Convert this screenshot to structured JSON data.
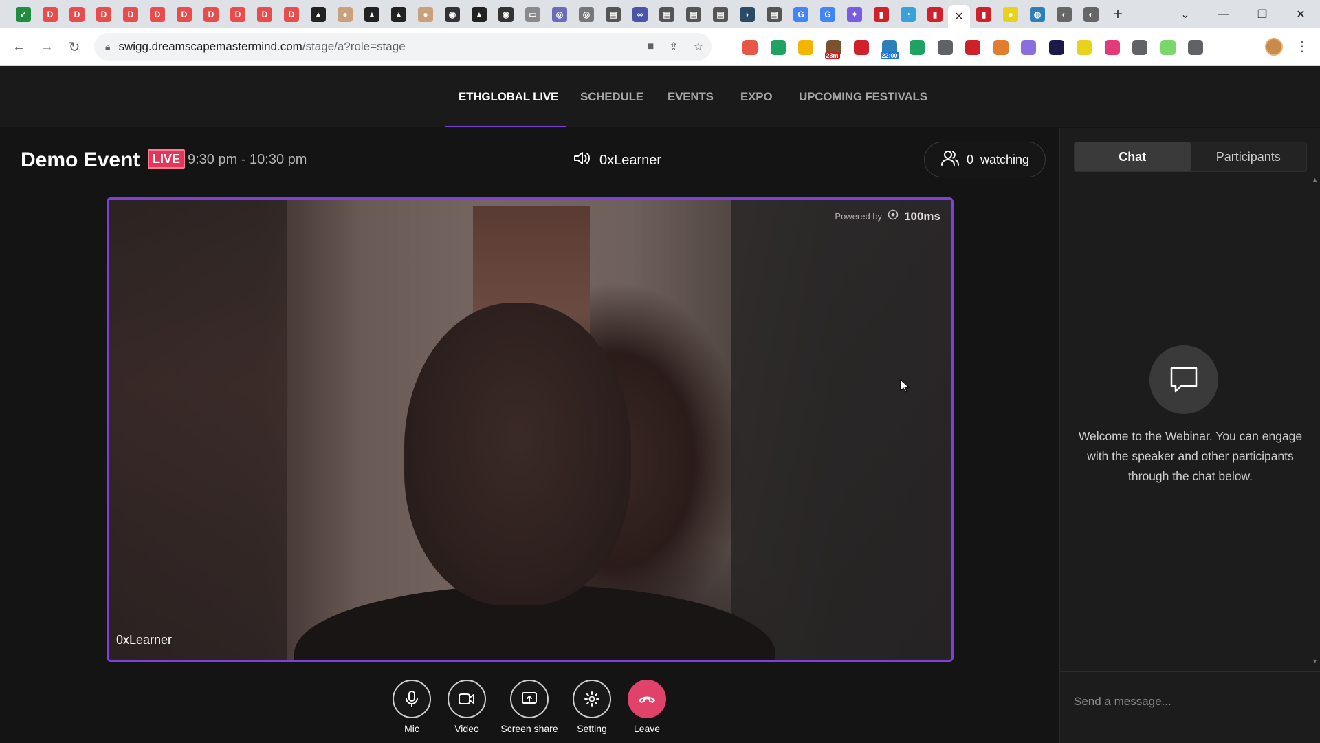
{
  "browser": {
    "url_host": "swigg.dreamscapemastermind.com",
    "url_path": "/stage/a?role=stage",
    "tab_close": "✕",
    "new_tab": "+",
    "tab_icons": [
      {
        "color": "#1e8e3e",
        "glyph": "✓"
      },
      {
        "color": "#e84d4d",
        "glyph": "D"
      },
      {
        "color": "#e84d4d",
        "glyph": "D"
      },
      {
        "color": "#e84d4d",
        "glyph": "D"
      },
      {
        "color": "#e84d4d",
        "glyph": "D"
      },
      {
        "color": "#e84d4d",
        "glyph": "D"
      },
      {
        "color": "#e84d4d",
        "glyph": "D"
      },
      {
        "color": "#e84d4d",
        "glyph": "D"
      },
      {
        "color": "#e84d4d",
        "glyph": "D"
      },
      {
        "color": "#e84d4d",
        "glyph": "D"
      },
      {
        "color": "#e84d4d",
        "glyph": "D"
      },
      {
        "color": "#222222",
        "glyph": "▲"
      },
      {
        "color": "#c9a07a",
        "glyph": "●"
      },
      {
        "color": "#222222",
        "glyph": "▲"
      },
      {
        "color": "#222222",
        "glyph": "▲"
      },
      {
        "color": "#c9a07a",
        "glyph": "●"
      },
      {
        "color": "#333333",
        "glyph": "◉"
      },
      {
        "color": "#222222",
        "glyph": "▲"
      },
      {
        "color": "#333333",
        "glyph": "◉"
      },
      {
        "color": "#8a8a8a",
        "glyph": "▭"
      },
      {
        "color": "#6b6bb8",
        "glyph": "◎"
      },
      {
        "color": "#777777",
        "glyph": "◎"
      },
      {
        "color": "#555555",
        "glyph": "▤"
      },
      {
        "color": "#4a55a8",
        "glyph": "∞"
      },
      {
        "color": "#555555",
        "glyph": "▤"
      },
      {
        "color": "#555555",
        "glyph": "▤"
      },
      {
        "color": "#555555",
        "glyph": "▤"
      },
      {
        "color": "#2a4a66",
        "glyph": "◗"
      },
      {
        "color": "#555555",
        "glyph": "▤"
      },
      {
        "color": "#4285f4",
        "glyph": "G"
      },
      {
        "color": "#4285f4",
        "glyph": "G"
      },
      {
        "color": "#7a5ce0",
        "glyph": "✦"
      },
      {
        "color": "#d0202a",
        "glyph": "▮"
      },
      {
        "color": "#3aa0d8",
        "glyph": "◔"
      },
      {
        "color": "#d0202a",
        "glyph": "▮"
      }
    ],
    "tab_icons_after": [
      {
        "color": "#d0202a",
        "glyph": "▮"
      },
      {
        "color": "#e8d21a",
        "glyph": "●"
      },
      {
        "color": "#2c7fb8",
        "glyph": "◍"
      },
      {
        "color": "#666666",
        "glyph": "◐"
      },
      {
        "color": "#666666",
        "glyph": "◐"
      }
    ],
    "ext_colors": [
      "#e8564a",
      "#1ea362",
      "#f4b400",
      "#7a5230",
      "#d0202a",
      "#2c7fb8",
      "#1ea362",
      "#5f6368",
      "#d0202a",
      "#e27c2e",
      "#8a6ee0",
      "#1a1a4a",
      "#e8d21a",
      "#e23a7a",
      "#5f6368",
      "#7ad86b",
      "#5f6368"
    ],
    "ext_badge_1": "23m",
    "ext_badge_2": "22:00"
  },
  "appnav": {
    "items": [
      "ETHGLOBAL LIVE",
      "SCHEDULE",
      "EVENTS",
      "EXPO",
      "UPCOMING FESTIVALS"
    ]
  },
  "stage": {
    "title": "Demo Event",
    "live_label": "LIVE",
    "time_range": "9:30 pm - 10:30 pm",
    "speaker_name": "0xLearner",
    "watching_count": "0",
    "watching_label": "watching"
  },
  "video": {
    "powered_by": "Powered by",
    "brand": "100ms",
    "participant_name": "0xLearner"
  },
  "controls": [
    {
      "label": "Mic",
      "icon": "mic-icon"
    },
    {
      "label": "Video",
      "icon": "video-camera-icon"
    },
    {
      "label": "Screen share",
      "icon": "screen-share-icon"
    },
    {
      "label": "Setting",
      "icon": "gear-icon"
    },
    {
      "label": "Leave",
      "icon": "phone-hangup-icon"
    }
  ],
  "panel": {
    "tabs": [
      "Chat",
      "Participants"
    ],
    "welcome_text": "Welcome to the Webinar. You can engage with the speaker and other participants through the chat below.",
    "message_placeholder": "Send a message..."
  },
  "colors": {
    "accent": "#7e3fe0",
    "live": "#e0375a",
    "leave": "#e0426a"
  }
}
